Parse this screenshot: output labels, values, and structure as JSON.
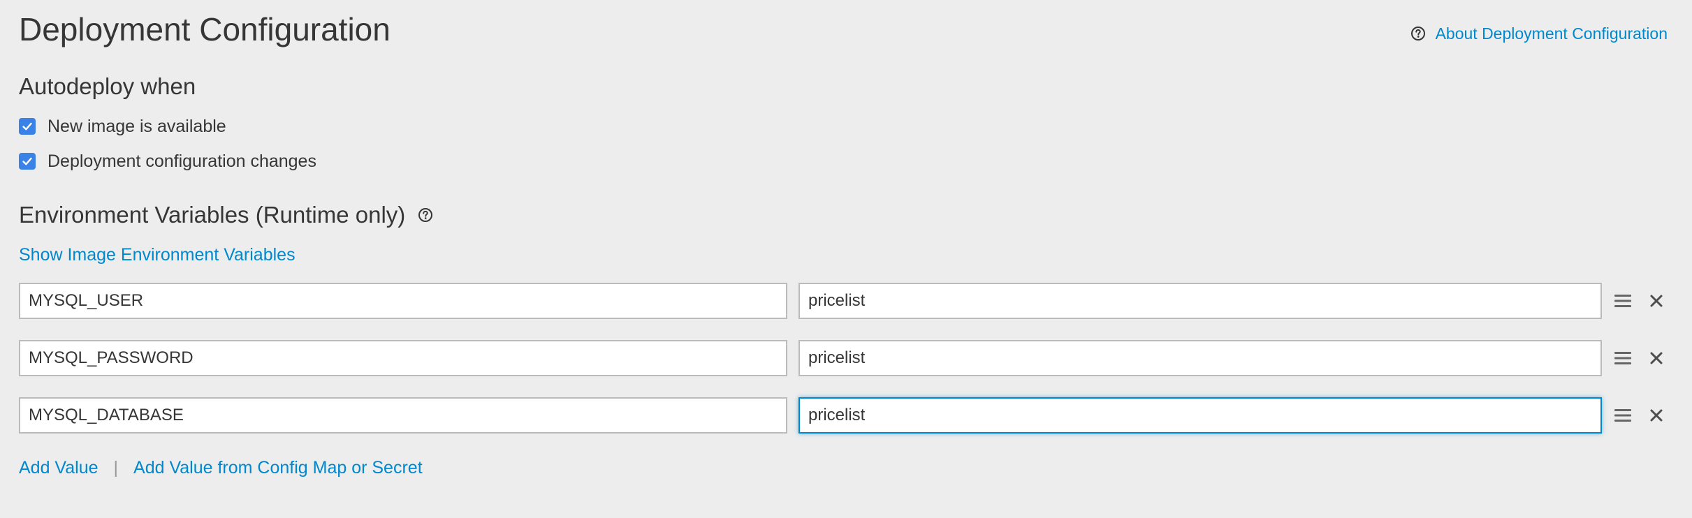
{
  "page": {
    "title": "Deployment Configuration",
    "about_link": "About Deployment Configuration"
  },
  "autodeploy": {
    "heading": "Autodeploy when",
    "options": [
      {
        "label": "New image is available",
        "checked": true
      },
      {
        "label": "Deployment configuration changes",
        "checked": true
      }
    ]
  },
  "env": {
    "heading": "Environment Variables (Runtime only)",
    "show_image_link": "Show Image Environment Variables",
    "rows": [
      {
        "name": "MYSQL_USER",
        "value": "pricelist"
      },
      {
        "name": "MYSQL_PASSWORD",
        "value": "pricelist"
      },
      {
        "name": "MYSQL_DATABASE",
        "value": "pricelist",
        "focused": true
      }
    ],
    "add_value_link": "Add Value",
    "separator": "|",
    "add_from_config_link": "Add Value from Config Map or Secret"
  },
  "colors": {
    "link": "#0088ce",
    "checkbox": "#3b82e6",
    "background": "#ededed",
    "text": "#363636",
    "focus_border": "#0088ce"
  },
  "icons": {
    "help": "question-circle-icon",
    "checkbox": "checkmark-icon",
    "drag": "drag-handle-icon",
    "remove": "close-icon"
  }
}
